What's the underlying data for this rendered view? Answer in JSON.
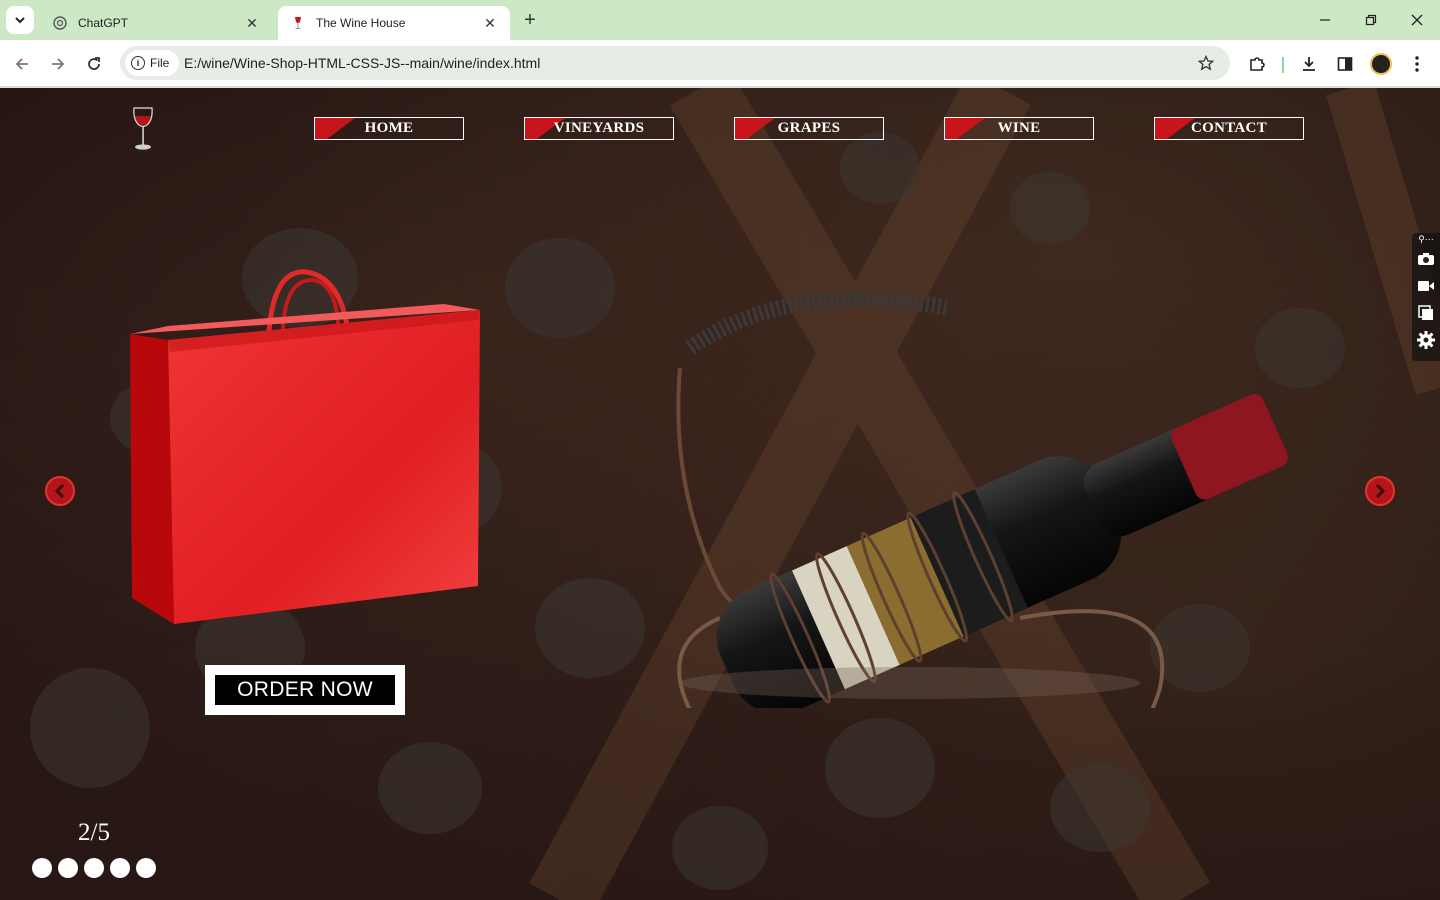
{
  "browser": {
    "tabs": [
      {
        "title": "ChatGPT",
        "active": false
      },
      {
        "title": "The Wine House",
        "active": true
      }
    ],
    "scheme_chip": "File",
    "url": "E:/wine/Wine-Shop-HTML-CSS-JS--main/wine/index.html"
  },
  "site": {
    "nav": [
      "HOME",
      "VINEYARDS",
      "GRAPES",
      "WINE",
      "CONTACT"
    ],
    "cta_label": "ORDER NOW",
    "slide_counter": "2/5",
    "slide_count": 5,
    "current_slide": 2
  },
  "colors": {
    "accent": "#c8141b",
    "chrome": "#cce8c4",
    "page_bg": "#2a1a18"
  }
}
